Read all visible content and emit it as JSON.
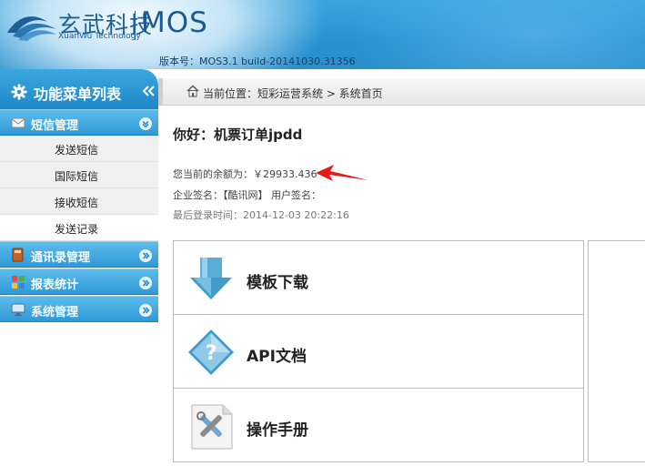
{
  "header": {
    "brand_cn": "玄武科技",
    "brand_en": "XuanWu Technology",
    "product": "MOS",
    "version": "版本号：MOS3.1 build-20141030.31356"
  },
  "sidebar": {
    "title": "功能菜单列表",
    "groups": [
      {
        "label": "短信管理",
        "icon": "envelope-icon",
        "expanded": true,
        "items": [
          "发送短信",
          "国际短信",
          "接收短信",
          "发送记录"
        ]
      },
      {
        "label": "通讯录管理",
        "icon": "address-book-icon",
        "expanded": false
      },
      {
        "label": "报表统计",
        "icon": "report-grid-icon",
        "expanded": false
      },
      {
        "label": "系统管理",
        "icon": "monitor-icon",
        "expanded": false
      }
    ],
    "active_item": "发送记录"
  },
  "breadcrumb": {
    "text": "当前位置：短彩运营系统 > 系统首页"
  },
  "main": {
    "greeting": "你好：机票订单jpdd",
    "balance": "您当前的余额为：￥29933.436",
    "signature": "企业签名：【酷讯网】 用户签名：",
    "last_login": "最后登录时间：2014-12-03 20:22:16",
    "cards": [
      {
        "label": "模板下载",
        "icon": "download-arrow-icon"
      },
      {
        "label": "API文档",
        "icon": "question-diamond-icon"
      },
      {
        "label": "操作手册",
        "icon": "tools-manual-icon"
      }
    ]
  },
  "colors": {
    "header_blue": "#2692d2",
    "menu_blue": "#2f9ad8",
    "arrow_red": "#e81818"
  }
}
